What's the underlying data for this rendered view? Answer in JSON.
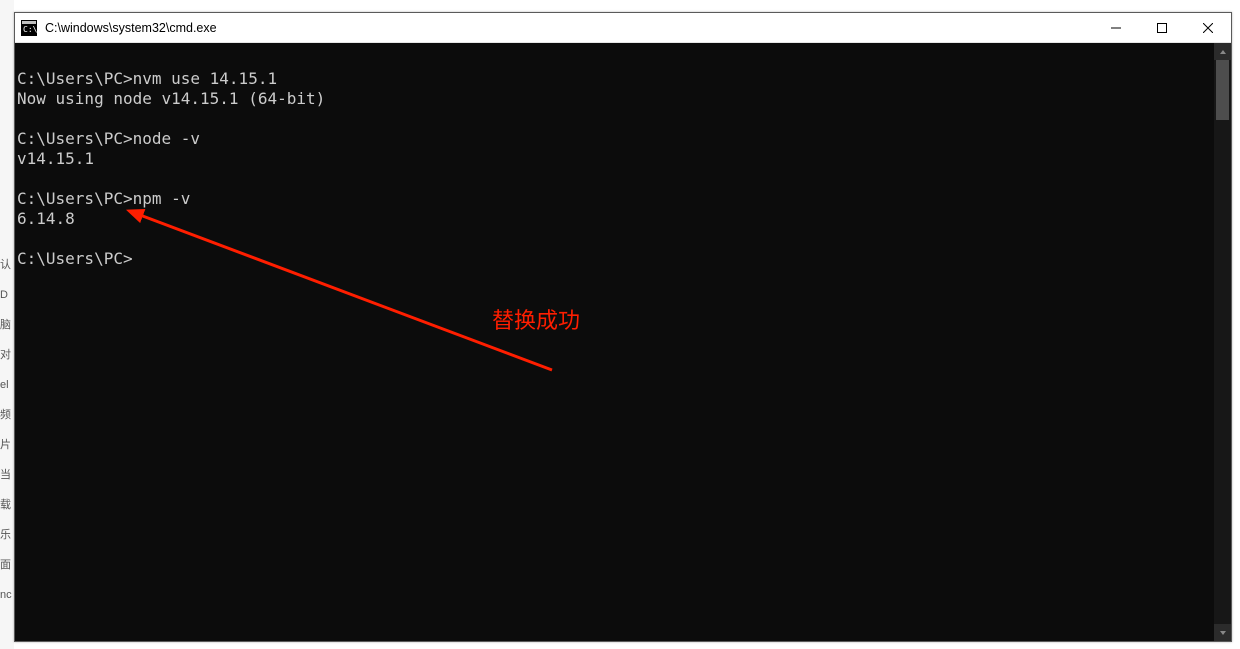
{
  "window": {
    "title": "C:\\windows\\system32\\cmd.exe"
  },
  "terminal": {
    "lines": [
      {
        "prompt": "C:\\Users\\PC>",
        "cmd": "nvm use 14.15.1"
      },
      {
        "out": "Now using node v14.15.1 (64-bit)"
      },
      {
        "blank": true
      },
      {
        "prompt": "C:\\Users\\PC>",
        "cmd": "node -v"
      },
      {
        "out": "v14.15.1"
      },
      {
        "blank": true
      },
      {
        "prompt": "C:\\Users\\PC>",
        "cmd": "npm -v"
      },
      {
        "out": "6.14.8"
      },
      {
        "blank": true
      },
      {
        "prompt": "C:\\Users\\PC>",
        "cmd": ""
      }
    ]
  },
  "annotation": {
    "label": "替换成功"
  },
  "left_strip": {
    "items": [
      "认",
      "D",
      "脑",
      "对",
      "el",
      "频",
      "片",
      "当",
      "载",
      "乐",
      "面",
      "nc"
    ]
  }
}
